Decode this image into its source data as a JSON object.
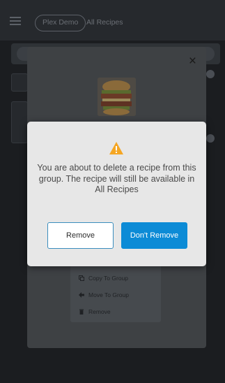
{
  "header": {
    "crumb_pill": "Plex Demo",
    "crumb_current": "All Recipes"
  },
  "sheet": {
    "close_label": "×",
    "menu": [
      {
        "label": "Copy To Group",
        "icon": "copy-icon"
      },
      {
        "label": "Move To Group",
        "icon": "move-icon"
      },
      {
        "label": "Remove",
        "icon": "trash-icon"
      }
    ]
  },
  "dialog": {
    "icon": "warning-icon",
    "message": "You are about to delete a recipe from this group. The recipe will still be available in All Recipes",
    "remove_label": "Remove",
    "keep_label": "Don't Remove"
  },
  "colors": {
    "accent": "#0c8bd6",
    "warning": "#f5a623"
  }
}
